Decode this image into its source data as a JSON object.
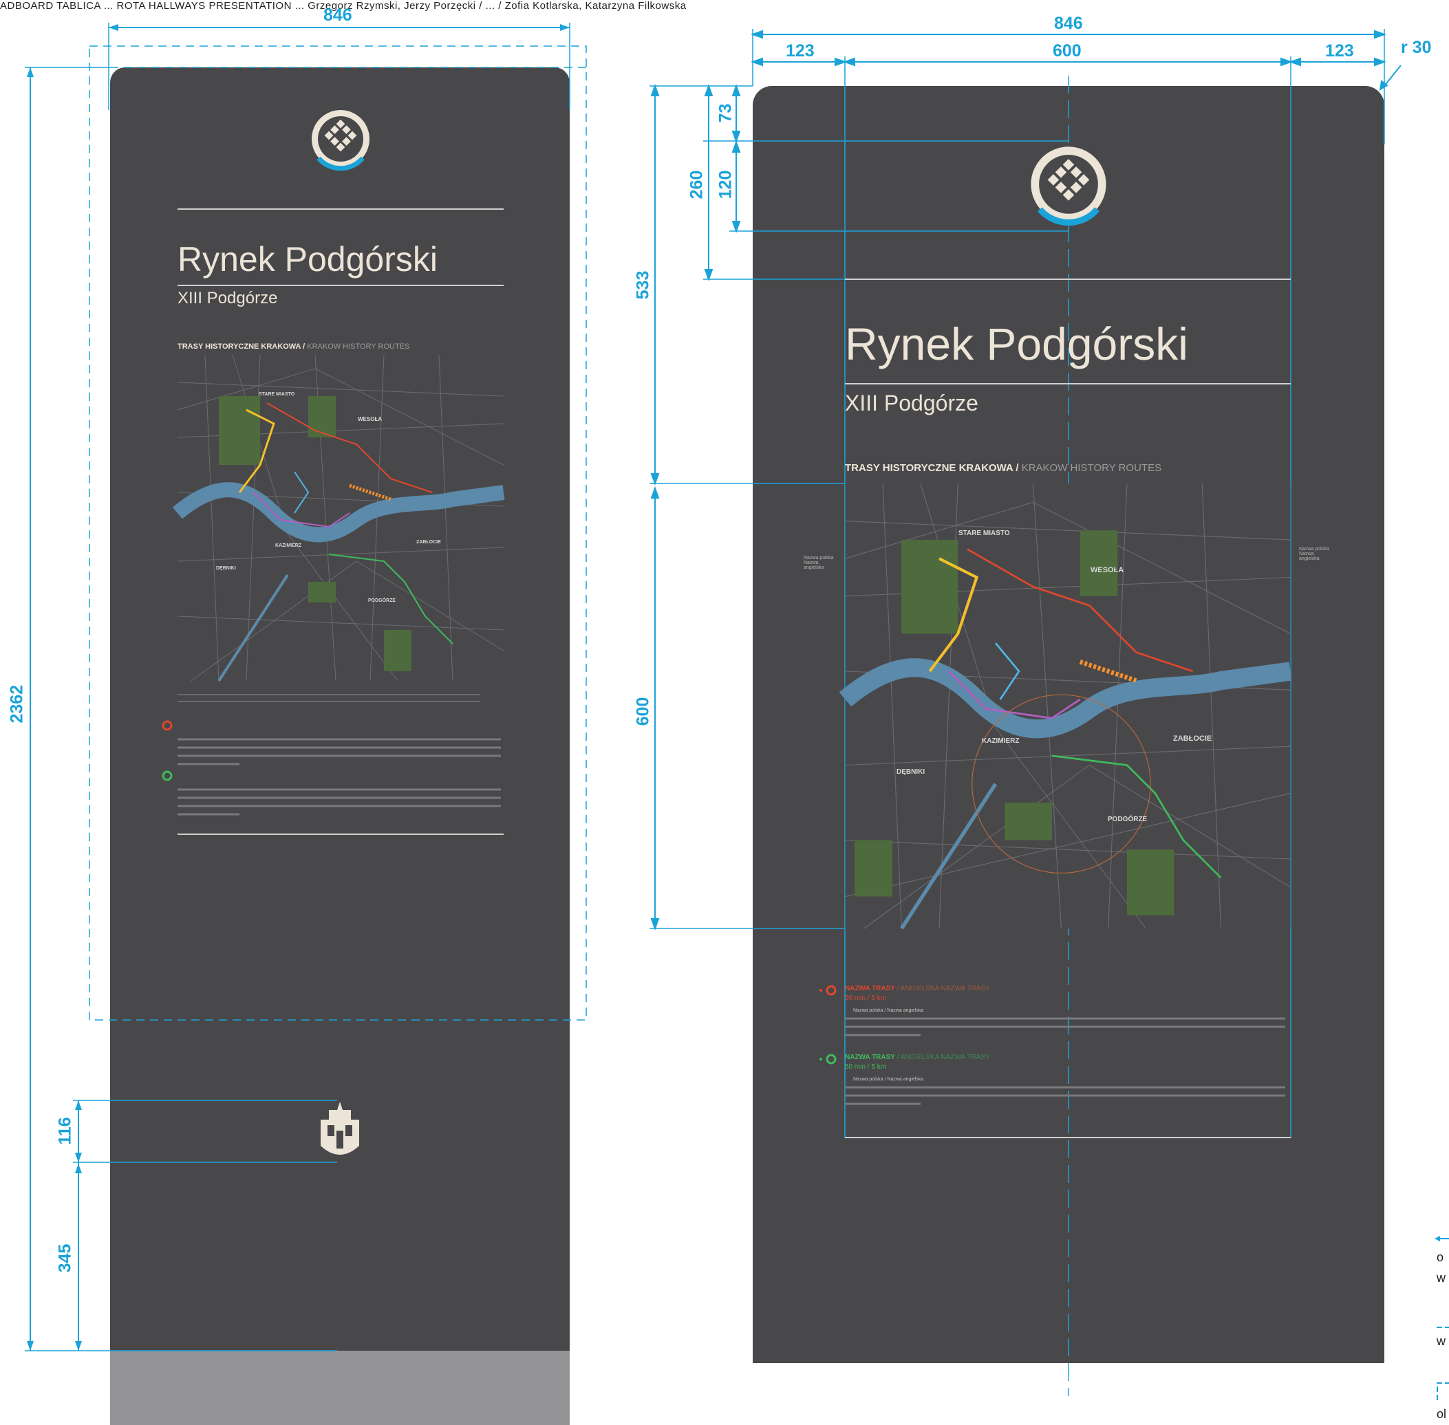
{
  "header_text": "ADBOARD TABLICA ... ROTA HALLWAYS PRESENTATION ... Grzegorz Rzymski, Jerzy Porzęcki / ... / Zofia Kotlarska, Katarzyna Filkowska",
  "colors": {
    "panel": "#48484b",
    "base": "#949497",
    "dim": "#1aa3d9",
    "title": "#ece4d6",
    "river": "#5b8aaa",
    "green_area": "#4e6b3e",
    "route_red": "#e0472b",
    "route_orange": "#f18e2c",
    "route_yellow": "#f2c02b",
    "route_blue": "#4fb6e6",
    "route_purple": "#b35fc1",
    "route_green": "#3fba5a"
  },
  "left_board": {
    "width_label": "846",
    "height_label": "2362",
    "crest_height_label": "116",
    "crest_offset_label": "345",
    "title": "Rynek Podgórski",
    "subtitle": "XIII Podgórze",
    "routes_header": "TRASY HISTORYCZNE KRAKOWA /",
    "routes_header_en": "KRAKOW HISTORY ROUTES",
    "map_labels": [
      "STARE MIASTO",
      "WESOŁA",
      "KAZIMIERZ",
      "ZABŁOCIE",
      "DĘBNIKI",
      "PODGÓRZE"
    ]
  },
  "right_board": {
    "width_label": "846",
    "margin_left_label": "123",
    "content_width_label": "600",
    "margin_right_label": "123",
    "radius_label": "r 30",
    "logo_top_label": "73",
    "logo_height_label": "120",
    "header_block_label": "260",
    "title_block_label": "533",
    "map_height_label": "600",
    "title": "Rynek Podgórski",
    "subtitle": "XIII Podgórze",
    "routes_header": "TRASY HISTORYCZNE KRAKOWA /",
    "routes_header_en": "KRAKOW HISTORY ROUTES",
    "map_labels": [
      "STARE MIASTO",
      "WESOŁA",
      "KAZIMIERZ",
      "ZABŁOCIE",
      "DĘBNIKI",
      "PODGÓRZE"
    ],
    "route1_name": "NAZWA TRASY",
    "route1_name_en": "/ ANGIELSKA NAZWA TRASY",
    "route1_time": "50 min / 5 km",
    "route2_name": "NAZWA TRASY",
    "route2_name_en": "/ ANGIELSKA NAZWA TRASY",
    "route2_time": "50 min / 5 km",
    "stop_text": "Nazwa polska / Nazwa angielska",
    "side_caption": "Nazwa polska Nazwa angielska"
  },
  "legend_fragments": [
    "o",
    "w",
    "w",
    "ol"
  ]
}
